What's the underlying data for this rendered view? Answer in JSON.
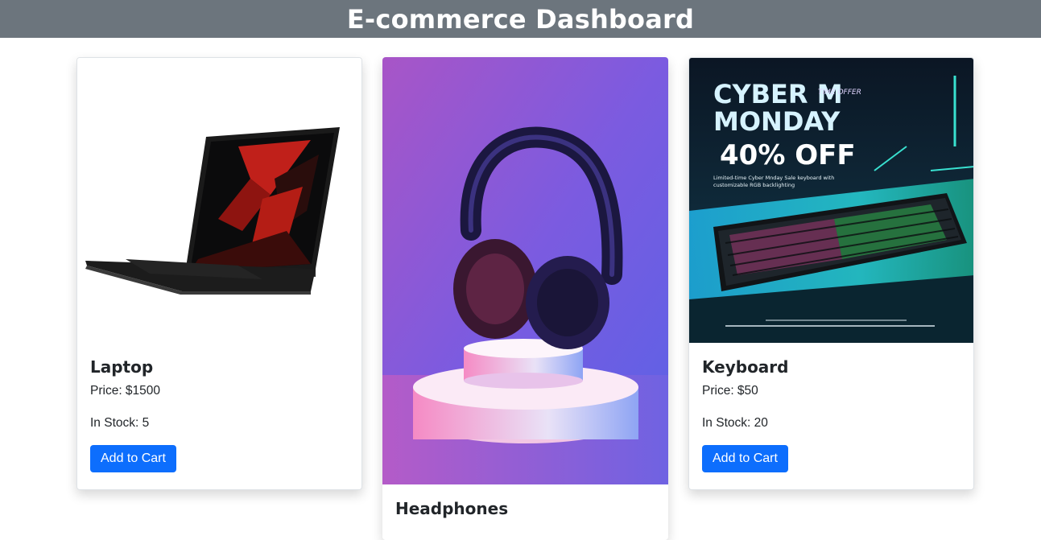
{
  "header": {
    "title": "E-commerce Dashboard"
  },
  "products": [
    {
      "name": "Laptop",
      "price": "Price: $1500",
      "stock": "In Stock: 5",
      "button": "Add to Cart",
      "image": "laptop-image"
    },
    {
      "name": "Headphones",
      "image": "headphones-image"
    },
    {
      "name": "Keyboard",
      "price": "Price: $50",
      "stock": "In Stock: 20",
      "button": "Add to Cart",
      "image": "keyboard-image",
      "promo": {
        "line1": "CYBER M",
        "line2": "MONDAY",
        "line3": "40% OFF",
        "tag": "TIME OFFER",
        "desc1": "Limited-time Cyber Mnday Sale keyboard with",
        "desc2": "customizable RGB backlighting"
      }
    }
  ],
  "colors": {
    "header_bg": "#6c757d",
    "button_bg": "#0d6efd"
  }
}
